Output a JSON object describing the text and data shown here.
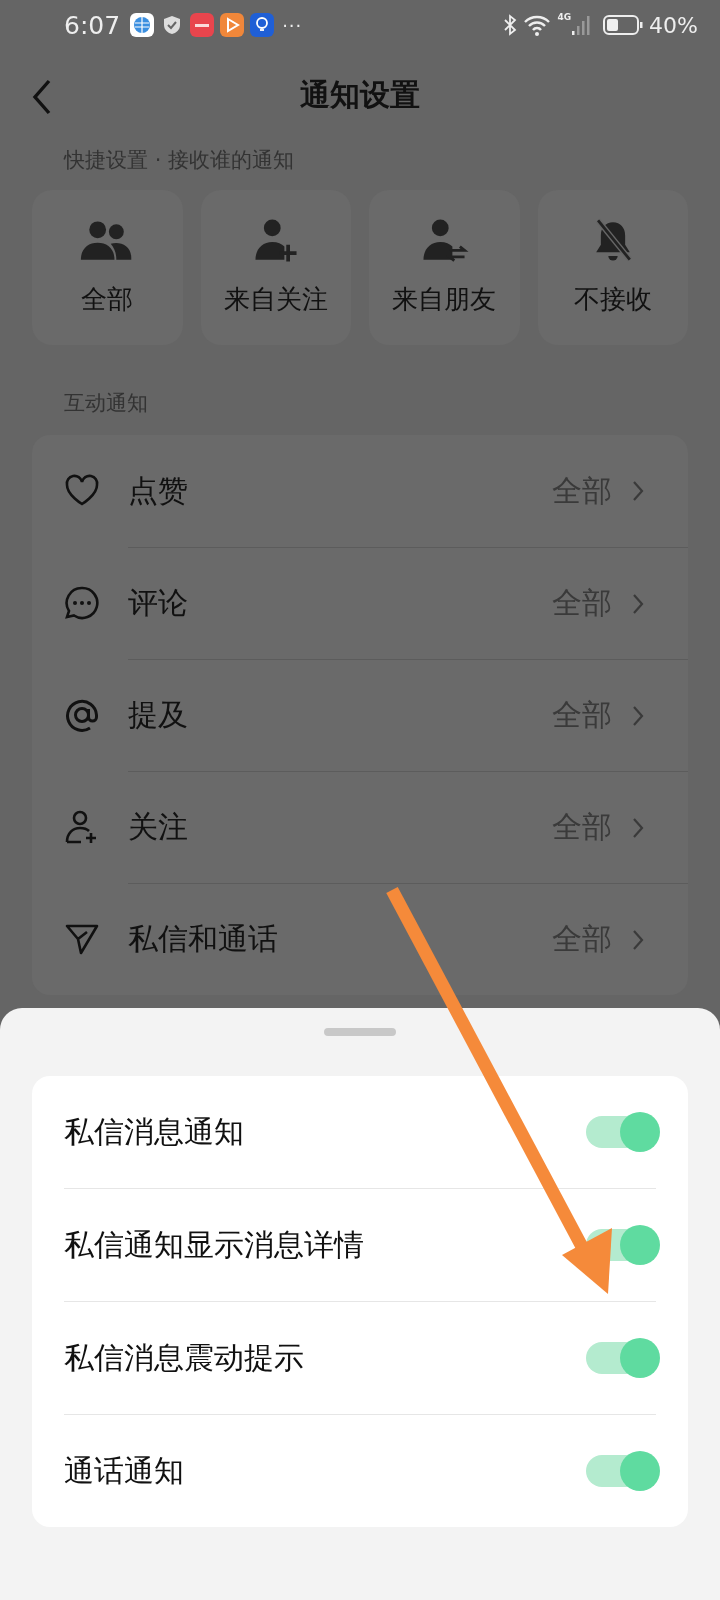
{
  "status_bar": {
    "time": "6:07",
    "more": "···",
    "network": "4G",
    "battery": "40%"
  },
  "header": {
    "title": "通知设置"
  },
  "quick_settings": {
    "label": "快捷设置 · 接收谁的通知",
    "options": [
      {
        "kind": "all",
        "label": "全部"
      },
      {
        "kind": "following",
        "label": "来自关注"
      },
      {
        "kind": "friends",
        "label": "来自朋友"
      },
      {
        "kind": "none",
        "label": "不接收"
      }
    ]
  },
  "interaction": {
    "label": "互动通知",
    "items": [
      {
        "kind": "like",
        "label": "点赞",
        "value": "全部"
      },
      {
        "kind": "comment",
        "label": "评论",
        "value": "全部"
      },
      {
        "kind": "mention",
        "label": "提及",
        "value": "全部"
      },
      {
        "kind": "follow",
        "label": "关注",
        "value": "全部"
      },
      {
        "kind": "message",
        "label": "私信和通话",
        "value": "全部"
      }
    ]
  },
  "sheet": {
    "items": [
      {
        "label": "私信消息通知",
        "on": true
      },
      {
        "label": "私信通知显示消息详情",
        "on": true
      },
      {
        "label": "私信消息震动提示",
        "on": true
      },
      {
        "label": "通话通知",
        "on": true
      }
    ]
  }
}
